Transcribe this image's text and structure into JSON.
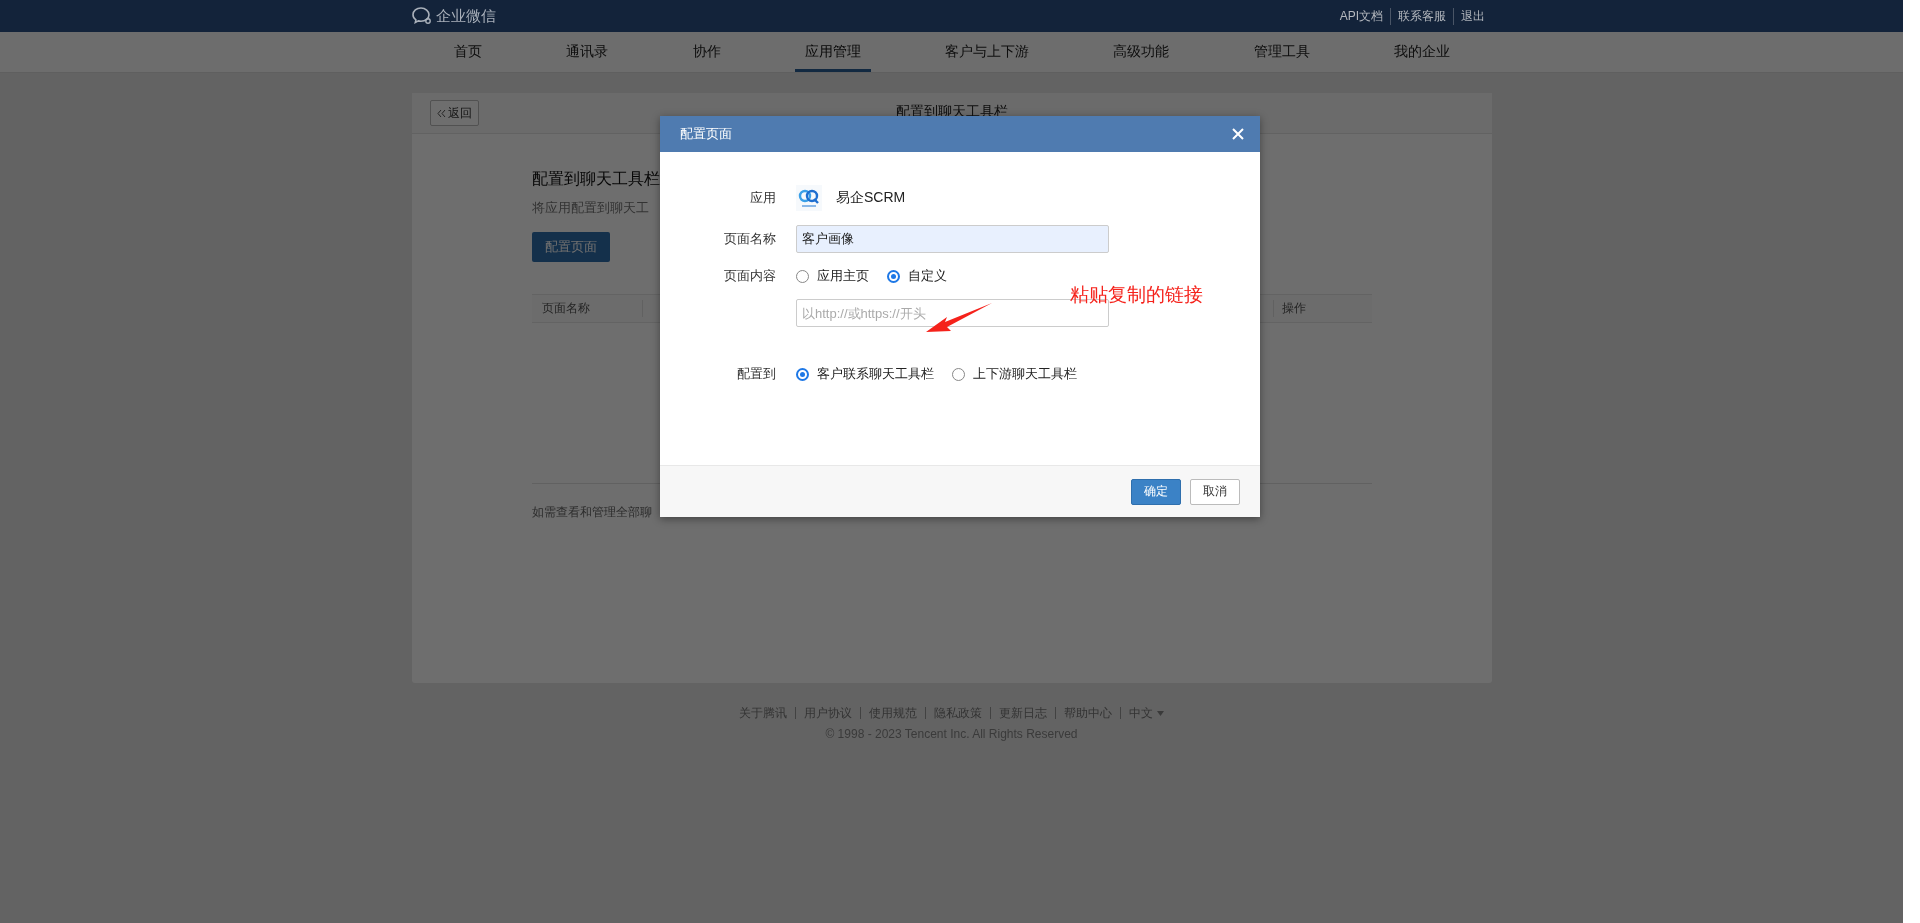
{
  "top_bar": {
    "logo_text": "企业微信",
    "links": [
      "API文档",
      "联系客服",
      "退出"
    ]
  },
  "nav": [
    {
      "label": "首页",
      "selected": false
    },
    {
      "label": "通讯录",
      "selected": false
    },
    {
      "label": "协作",
      "selected": false
    },
    {
      "label": "应用管理",
      "selected": true
    },
    {
      "label": "客户与上下游",
      "selected": false
    },
    {
      "label": "高级功能",
      "selected": false
    },
    {
      "label": "管理工具",
      "selected": false
    },
    {
      "label": "我的企业",
      "selected": false
    }
  ],
  "page": {
    "back_button": "返回",
    "title": "配置到聊天工具栏",
    "heading": "配置到聊天工具栏",
    "description": "将应用配置到聊天工",
    "config_button": "配置页面",
    "table": {
      "columns": [
        "页面名称",
        "操作"
      ]
    },
    "note": "如需查看和管理全部聊"
  },
  "footer": {
    "links": [
      "关于腾讯",
      "用户协议",
      "使用规范",
      "隐私政策",
      "更新日志",
      "帮助中心"
    ],
    "language": "中文",
    "copyright": "© 1998 - 2023 Tencent Inc. All Rights Reserved"
  },
  "dialog": {
    "title": "配置页面",
    "app": {
      "label": "应用",
      "name": "易企SCRM"
    },
    "page_name": {
      "label": "页面名称",
      "value": "客户画像"
    },
    "page_content": {
      "label": "页面内容",
      "options": [
        {
          "label": "应用主页",
          "selected": false
        },
        {
          "label": "自定义",
          "selected": true
        }
      ],
      "url": {
        "placeholder": "以http://或https://开头"
      }
    },
    "configure_to": {
      "label": "配置到",
      "options": [
        {
          "label": "客户联系聊天工具栏",
          "selected": true
        },
        {
          "label": "上下游聊天工具栏",
          "selected": false
        }
      ]
    },
    "buttons": [
      {
        "label": "确定",
        "kind": "primary"
      },
      {
        "label": "取消",
        "kind": "default"
      }
    ]
  },
  "annotation": {
    "text": "粘贴复制的链接"
  }
}
